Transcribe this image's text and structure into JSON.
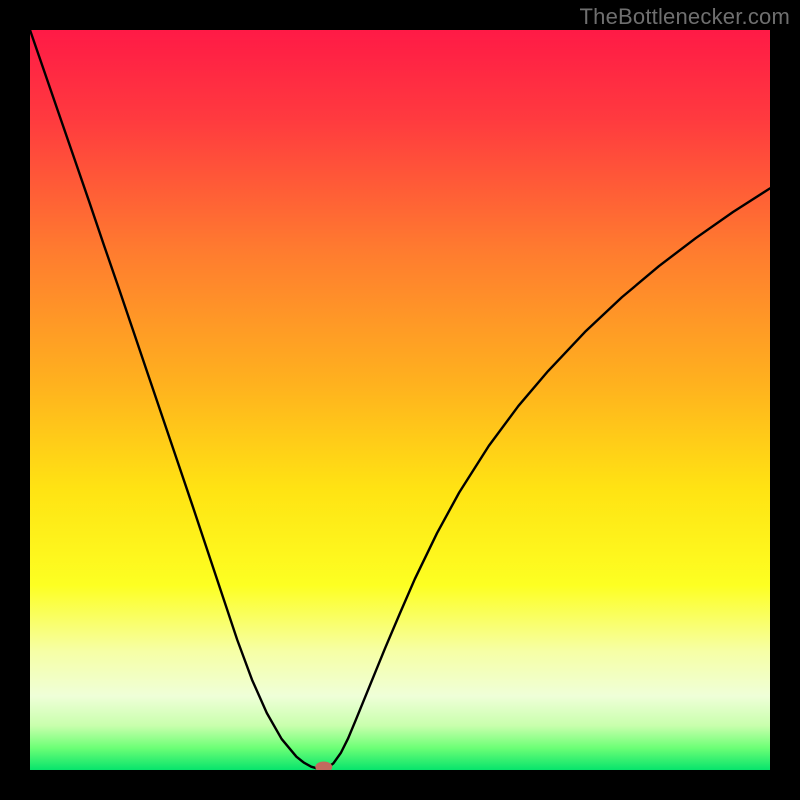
{
  "watermark": "TheBottlenecker.com",
  "chart_data": {
    "type": "line",
    "title": "",
    "xlabel": "",
    "ylabel": "",
    "xlim": [
      0,
      100
    ],
    "ylim": [
      0,
      100
    ],
    "background_gradient": {
      "stops": [
        {
          "offset": 0,
          "color": "#ff1a46"
        },
        {
          "offset": 12,
          "color": "#ff3a3f"
        },
        {
          "offset": 30,
          "color": "#ff7c2f"
        },
        {
          "offset": 48,
          "color": "#ffb21e"
        },
        {
          "offset": 62,
          "color": "#ffe313"
        },
        {
          "offset": 75,
          "color": "#fdff22"
        },
        {
          "offset": 84,
          "color": "#f6ffa6"
        },
        {
          "offset": 90,
          "color": "#efffd8"
        },
        {
          "offset": 94,
          "color": "#c9ffad"
        },
        {
          "offset": 97,
          "color": "#6dff76"
        },
        {
          "offset": 100,
          "color": "#07e46c"
        }
      ]
    },
    "series": [
      {
        "name": "curve",
        "color": "#000000",
        "stroke_width": 2.4,
        "x": [
          0,
          2,
          4,
          6,
          8,
          10,
          12,
          14,
          16,
          18,
          20,
          22,
          24,
          26,
          28,
          30,
          32,
          34,
          36,
          37,
          38,
          39,
          40,
          41,
          42,
          43,
          44,
          46,
          48,
          50,
          52,
          55,
          58,
          62,
          66,
          70,
          75,
          80,
          85,
          90,
          95,
          100
        ],
        "y": [
          100,
          94.2,
          88.4,
          82.6,
          76.8,
          70.9,
          65.1,
          59.2,
          53.3,
          47.4,
          41.5,
          35.6,
          29.6,
          23.6,
          17.6,
          12.2,
          7.7,
          4.2,
          1.8,
          1.0,
          0.45,
          0.15,
          0.2,
          0.9,
          2.3,
          4.3,
          6.7,
          11.6,
          16.5,
          21.2,
          25.8,
          32.0,
          37.5,
          43.8,
          49.2,
          53.9,
          59.2,
          63.9,
          68.1,
          71.9,
          75.4,
          78.6
        ]
      }
    ],
    "marker": {
      "cx": 39.7,
      "cy": 0.4,
      "rx": 1.15,
      "ry": 0.75,
      "fill": "#c36a5e"
    }
  }
}
